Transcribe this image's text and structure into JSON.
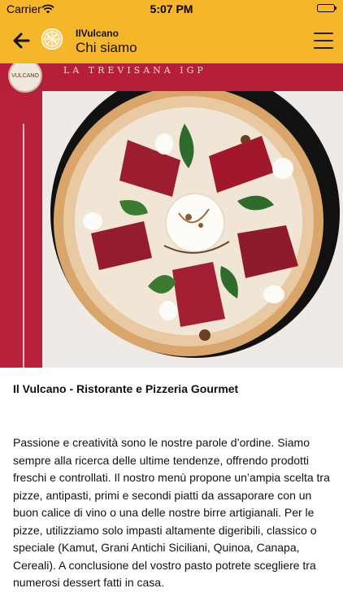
{
  "status_bar": {
    "carrier": "Carrier",
    "time": "5:07 PM"
  },
  "nav": {
    "app_name": "IlVulcano",
    "page_title": "Chi siamo"
  },
  "hero": {
    "badge_text": "VULCANO",
    "banner_text": "LA TREVISANA IGP"
  },
  "content": {
    "subtitle": "Il Vulcano - Ristorante e Pizzeria Gourmet",
    "body": "Passione e creatività sono le nostre parole d’ordine. Siamo sempre alla ricerca delle ultime tendenze, offrendo prodotti freschi e controllati. Il nostro menù propone un’ampia scelta tra pizze, antipasti, primi e secondi piatti da assaporare con un buon calice di vino o una delle nostre birre artigianali. Per le pizze, utilizziamo solo impasti altamente digeribili, classico o speciale (Kamut, Grani Antichi Siciliani, Quinoa, Canapa, Cereali). A conclusione del vostro pasto potrete scegliere tra numerosi dessert fatti in casa."
  },
  "colors": {
    "accent": "#f6b62a",
    "hero_red": "#b9203a"
  }
}
